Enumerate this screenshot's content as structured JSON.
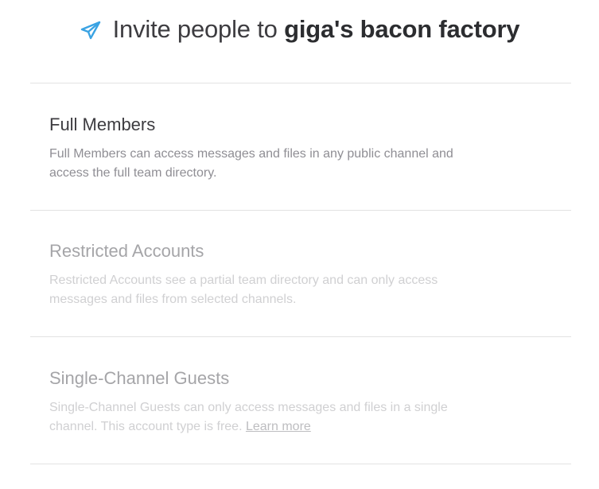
{
  "header": {
    "prefix": "Invite people to",
    "team_name": "giga's bacon factory",
    "icon": "paper-plane-icon",
    "accent_color": "#3aa3e3"
  },
  "options": [
    {
      "title": "Full Members",
      "description": "Full Members can access messages and files in any public channel and access the full team directory.",
      "enabled": true
    },
    {
      "title": "Restricted Accounts",
      "description": "Restricted Accounts see a partial team directory and can only access messages and files from selected channels.",
      "enabled": false
    },
    {
      "title": "Single-Channel Guests",
      "description": "Single-Channel Guests can only access messages and files in a single channel. This account type is free.",
      "link": "Learn more",
      "enabled": false
    }
  ]
}
